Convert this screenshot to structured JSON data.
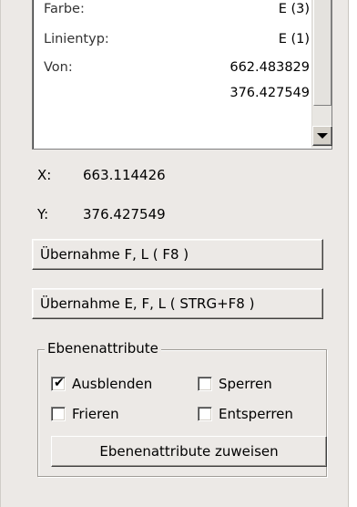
{
  "properties": [
    {
      "key": "Farbe:",
      "value": "E (3)"
    },
    {
      "key": "Linientyp:",
      "value": "E (1)"
    },
    {
      "key": "Von:",
      "value": "662.483829"
    },
    {
      "key": "",
      "value": "376.427549"
    }
  ],
  "coords": {
    "x_label": "X:",
    "x_value": "663.114426",
    "y_label": "Y:",
    "y_value": "376.427549"
  },
  "buttons": {
    "take_fl": "Übernahme  F, L ( F8 )",
    "take_efl": "Übernahme E, F, L ( STRG+F8 )"
  },
  "layer_attributes": {
    "title": "Ebenenattribute",
    "hide": {
      "label": "Ausblenden",
      "checked": true
    },
    "lock": {
      "label": "Sperren",
      "checked": false
    },
    "freeze": {
      "label": "Frieren",
      "checked": false
    },
    "unlock": {
      "label": "Entsperren",
      "checked": false
    },
    "assign_label": "Ebenenattribute zuweisen"
  },
  "icons": {
    "scroll_down": "triangle-down-icon",
    "checkmark": "✔"
  },
  "colors": {
    "panel_bg": "#ece9e6"
  }
}
